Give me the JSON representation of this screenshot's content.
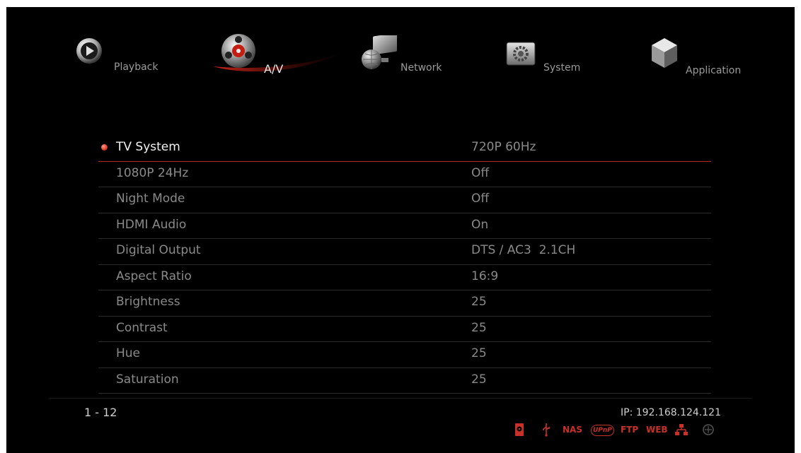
{
  "tabs": [
    {
      "id": "playback",
      "label": "Playback",
      "icon": "play-disc-icon",
      "active": false
    },
    {
      "id": "av",
      "label": "A/V",
      "icon": "film-reel-icon",
      "active": true
    },
    {
      "id": "network",
      "label": "Network",
      "icon": "globe-monitor-icon",
      "active": false
    },
    {
      "id": "system",
      "label": "System",
      "icon": "gear-panel-icon",
      "active": false
    },
    {
      "id": "application",
      "label": "Application",
      "icon": "cube-icon",
      "active": false
    }
  ],
  "settings": [
    {
      "name": "TV System",
      "value": "720P 60Hz",
      "selected": true
    },
    {
      "name": "1080P 24Hz",
      "value": "Off"
    },
    {
      "name": "Night Mode",
      "value": "Off"
    },
    {
      "name": "HDMI Audio",
      "value": "On"
    },
    {
      "name": "Digital Output",
      "value": "DTS / AC3  2.1CH"
    },
    {
      "name": "Aspect Ratio",
      "value": "16:9"
    },
    {
      "name": "Brightness",
      "value": "25"
    },
    {
      "name": "Contrast",
      "value": "25"
    },
    {
      "name": "Hue",
      "value": "25"
    },
    {
      "name": "Saturation",
      "value": "25"
    }
  ],
  "footer": {
    "page_range": "1 - 12",
    "ip": "IP: 192.168.124.121",
    "status_icons": [
      {
        "name": "hdd-icon",
        "label": ""
      },
      {
        "name": "usb-icon",
        "label": ""
      },
      {
        "name": "nas-icon",
        "label": "NAS"
      },
      {
        "name": "upnp-icon",
        "label": "UPnP"
      },
      {
        "name": "ftp-icon",
        "label": "FTP"
      },
      {
        "name": "web-icon",
        "label": "WEB"
      },
      {
        "name": "lan-icon",
        "label": ""
      },
      {
        "name": "wifi-icon",
        "label": ""
      }
    ]
  },
  "colors": {
    "accent": "#e02a1a",
    "background": "#000000",
    "text_active": "#f2f2f2",
    "text_inactive": "#8a8a8a"
  }
}
